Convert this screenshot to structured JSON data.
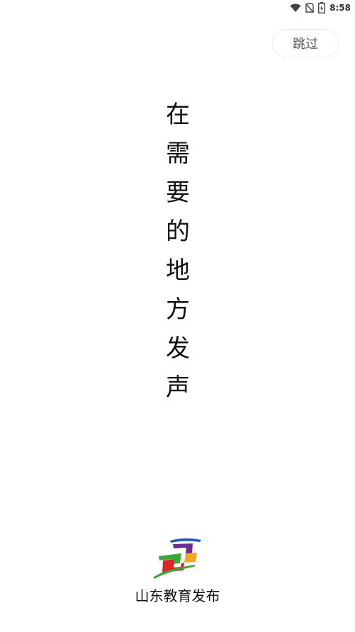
{
  "status_bar": {
    "time": "8:58",
    "icons": [
      "wifi-icon",
      "no-sim-icon",
      "battery-icon"
    ]
  },
  "skip_button": {
    "label": "跳过"
  },
  "slogan": {
    "chars": [
      "在",
      "需",
      "要",
      "的",
      "地",
      "方",
      "发",
      "声"
    ]
  },
  "brand": {
    "name": "山东教育发布"
  },
  "colors": {
    "background": "#ffffff",
    "text": "#111111",
    "skip_text": "#555555",
    "skip_border": "#ececec",
    "logo_blue": "#1e5bb8",
    "logo_purple": "#6a2c91",
    "logo_orange": "#f5a623",
    "logo_green": "#3aa935",
    "logo_red": "#d9262c"
  }
}
